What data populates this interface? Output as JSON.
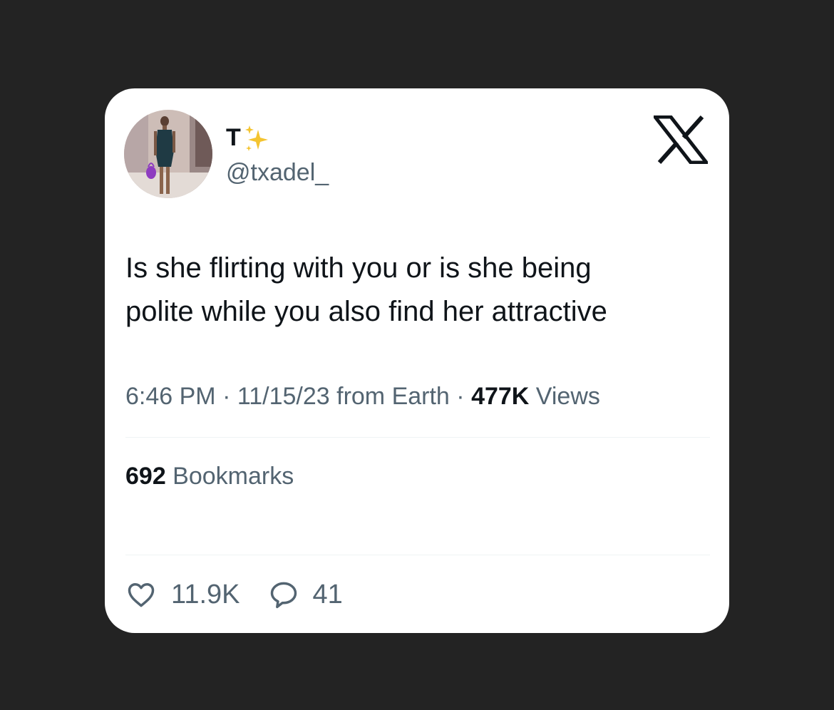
{
  "author": {
    "display_name": "T",
    "handle": "@txadel_"
  },
  "icons": {
    "avatar": "profile-photo",
    "name_emoji": "sparkles-icon",
    "logo": "x-logo-icon",
    "like": "heart-icon",
    "reply": "speech-bubble-icon"
  },
  "tweet": {
    "text_line1": "Is she flirting with you or is she being",
    "text_line2": "polite while you also find her attractive"
  },
  "meta": {
    "time": "6:46 PM",
    "sep1": " · ",
    "date": "11/15/23",
    "source": " from Earth",
    "sep2": " · ",
    "views_count": "477K",
    "views_label": " Views"
  },
  "bookmarks": {
    "count": "692",
    "label": " Bookmarks"
  },
  "actions": {
    "likes": "11.9K",
    "replies": "41"
  },
  "colors": {
    "background": "#232323",
    "card": "#ffffff",
    "primary_text": "#0f1419",
    "secondary_text": "#536471",
    "divider": "#eff3f4",
    "sparkle": "#f4c430"
  }
}
